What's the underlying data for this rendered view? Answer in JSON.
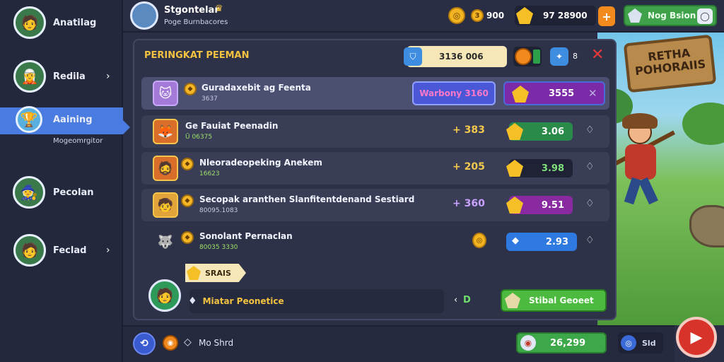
{
  "sidebar": {
    "items": [
      {
        "label": "Anatilag",
        "sub": ""
      },
      {
        "label": "Redila",
        "sub": ""
      },
      {
        "label": "Aaining",
        "sub": "Mogeomrgitor"
      },
      {
        "label": "Pecolan",
        "sub": ""
      },
      {
        "label": "Feclad",
        "sub": ""
      }
    ]
  },
  "topbar": {
    "player_name": "Stgontelar",
    "player_sub": "Poge Burnbacores",
    "coins": "900",
    "gems": "97 28900",
    "plus": "+",
    "event_label": "Nog Bsion"
  },
  "panel": {
    "title": "PERINGKAT PEEMAN",
    "timer": "3136 006",
    "badge_count": "8",
    "rows": [
      {
        "name": "Guradaxebit ag Feenta",
        "sub": "3637",
        "tag": "Warbony 3160",
        "points": "3555",
        "action": "✕"
      },
      {
        "name": "Ge Fauiat Peenadin",
        "sub": "Ū 06375",
        "score": "+ 383",
        "points": "3.06",
        "action": "♢"
      },
      {
        "name": "Nleoradeopeking Anekem",
        "sub": "16623",
        "score": "+ 205",
        "points": "3.98",
        "action": "♢"
      },
      {
        "name": "Secopak aranthen Slanfitentdenand Sestiard",
        "sub": "80095.1083",
        "score": "+ 360",
        "points": "9.51",
        "action": "♢"
      },
      {
        "name": "Sonolant Pernaclan",
        "sub": "80035 3330",
        "score": "",
        "points": "2.93",
        "action": "♢"
      }
    ],
    "self_rank_label": "SRAIS",
    "footer_name": "Miatar Peonetice",
    "footer_count": "D",
    "footer_button": "Stibal Geoeet"
  },
  "bottombar": {
    "label": "Mo Shrd",
    "reward": "26,299",
    "extra": "Sld"
  },
  "scene": {
    "sign_text": "RETHA POHORAIIS"
  }
}
